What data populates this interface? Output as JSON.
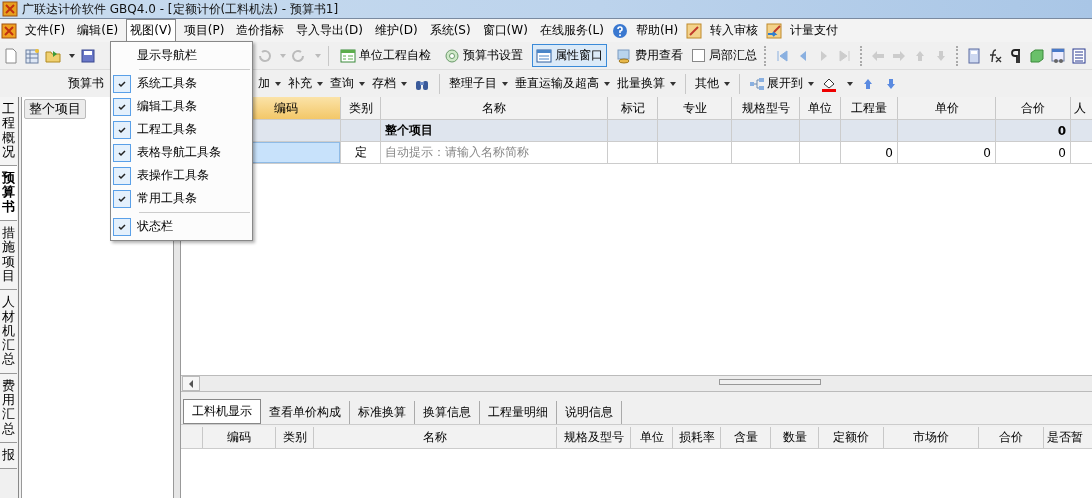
{
  "window": {
    "title": "广联达计价软件 GBQ4.0 - [定额计价(工料机法) - 预算书1]"
  },
  "menu_bar": [
    {
      "label": "文件(F)",
      "open": false
    },
    {
      "label": "编辑(E)",
      "open": false
    },
    {
      "label": "视图(V)",
      "open": true
    },
    {
      "label": "项目(P)",
      "open": false
    },
    {
      "label": "造价指标",
      "open": false
    },
    {
      "label": "导入导出(D)",
      "open": false
    },
    {
      "label": "维护(D)",
      "open": false
    },
    {
      "label": "系统(S)",
      "open": false
    },
    {
      "label": "窗口(W)",
      "open": false
    },
    {
      "label": "在线服务(L)",
      "open": false
    }
  ],
  "menu_bar_links": [
    {
      "label": "帮助(H)",
      "kind": "help"
    },
    {
      "label": "转入审核",
      "kind": "audit"
    },
    {
      "label": "计量支付",
      "kind": "pay"
    }
  ],
  "view_menu": [
    {
      "kind": "item",
      "label": "显示导航栏",
      "checked": false
    },
    {
      "kind": "separator"
    },
    {
      "kind": "item",
      "label": "系统工具条",
      "checked": true
    },
    {
      "kind": "item",
      "label": "编辑工具条",
      "checked": true
    },
    {
      "kind": "item",
      "label": "工程工具条",
      "checked": true
    },
    {
      "kind": "item",
      "label": "表格导航工具条",
      "checked": true
    },
    {
      "kind": "item",
      "label": "表操作工具条",
      "checked": true
    },
    {
      "kind": "item",
      "label": "常用工具条",
      "checked": true
    },
    {
      "kind": "separator"
    },
    {
      "kind": "item",
      "label": "状态栏",
      "checked": true
    }
  ],
  "toolbar": {
    "buttons": [
      {
        "label": "单位工程自检",
        "kind": "check",
        "pressed": false
      },
      {
        "label": "预算书设置",
        "kind": "settings",
        "pressed": false
      },
      {
        "label": "属性窗口",
        "kind": "window",
        "pressed": true
      },
      {
        "label": "费用查看",
        "kind": "coins",
        "pressed": false
      }
    ],
    "partial_summary": {
      "label": "局部汇总",
      "checked": false
    }
  },
  "nav_pane": {
    "title": "预算书",
    "tree": [
      {
        "label": "整个项目",
        "selected": true
      }
    ]
  },
  "side_tabs": [
    {
      "label": "工程概况",
      "selected": false
    },
    {
      "label": "预算书",
      "selected": true
    },
    {
      "label": "措施项目",
      "selected": false
    },
    {
      "label": "人材机汇总",
      "selected": false
    },
    {
      "label": "费用汇总",
      "selected": false
    },
    {
      "label": "报",
      "selected": false
    }
  ],
  "grid_toolbar": [
    {
      "label": "加",
      "kind": "dropdown"
    },
    {
      "label": "补充",
      "kind": "dropdown"
    },
    {
      "label": "查询",
      "kind": "dropdown"
    },
    {
      "label": "存档",
      "kind": "dropdown"
    },
    {
      "kind": "find"
    },
    {
      "kind": "sep"
    },
    {
      "label": "整理子目",
      "kind": "dropdown"
    },
    {
      "label": "垂直运输及超高",
      "kind": "dropdown"
    },
    {
      "label": "批量换算",
      "kind": "dropdown"
    },
    {
      "kind": "sep"
    },
    {
      "label": "其他",
      "kind": "dropdown"
    },
    {
      "kind": "sep"
    },
    {
      "label": "展开到",
      "kind": "expand"
    },
    {
      "kind": "paint"
    },
    {
      "kind": "up"
    },
    {
      "kind": "down"
    }
  ],
  "grid": {
    "columns": [
      {
        "label": "编码",
        "selected": true
      },
      {
        "label": "类别",
        "selected": false
      },
      {
        "label": "名称",
        "selected": false
      },
      {
        "label": "标记",
        "selected": false
      },
      {
        "label": "专业",
        "selected": false
      },
      {
        "label": "规格型号",
        "selected": false
      },
      {
        "label": "单位",
        "selected": false
      },
      {
        "label": "工程量",
        "selected": false
      },
      {
        "label": "单价",
        "selected": false
      },
      {
        "label": "合价",
        "selected": false
      },
      {
        "label": "人",
        "selected": false
      }
    ],
    "rows": [
      {
        "kind": "summary",
        "selected": false,
        "cells": [
          "",
          "",
          "整个项目",
          "",
          "",
          "",
          "",
          "",
          "",
          "0",
          ""
        ]
      },
      {
        "kind": "item",
        "selected": true,
        "cells": [
          "",
          "定",
          "",
          "",
          "",
          "",
          "",
          "0",
          "0",
          "0",
          ""
        ],
        "name_placeholder": "自动提示：请输入名称简称"
      }
    ]
  },
  "detail_tabs": [
    {
      "label": "工料机显示",
      "selected": true
    },
    {
      "label": "查看单价构成",
      "selected": false
    },
    {
      "label": "标准换算",
      "selected": false
    },
    {
      "label": "换算信息",
      "selected": false
    },
    {
      "label": "工程量明细",
      "selected": false
    },
    {
      "label": "说明信息",
      "selected": false
    }
  ],
  "detail_grid": {
    "columns": [
      "",
      "编码",
      "类别",
      "名称",
      "规格及型号",
      "单位",
      "损耗率",
      "含量",
      "数量",
      "定额价",
      "市场价",
      "合价",
      "是否暂"
    ]
  }
}
